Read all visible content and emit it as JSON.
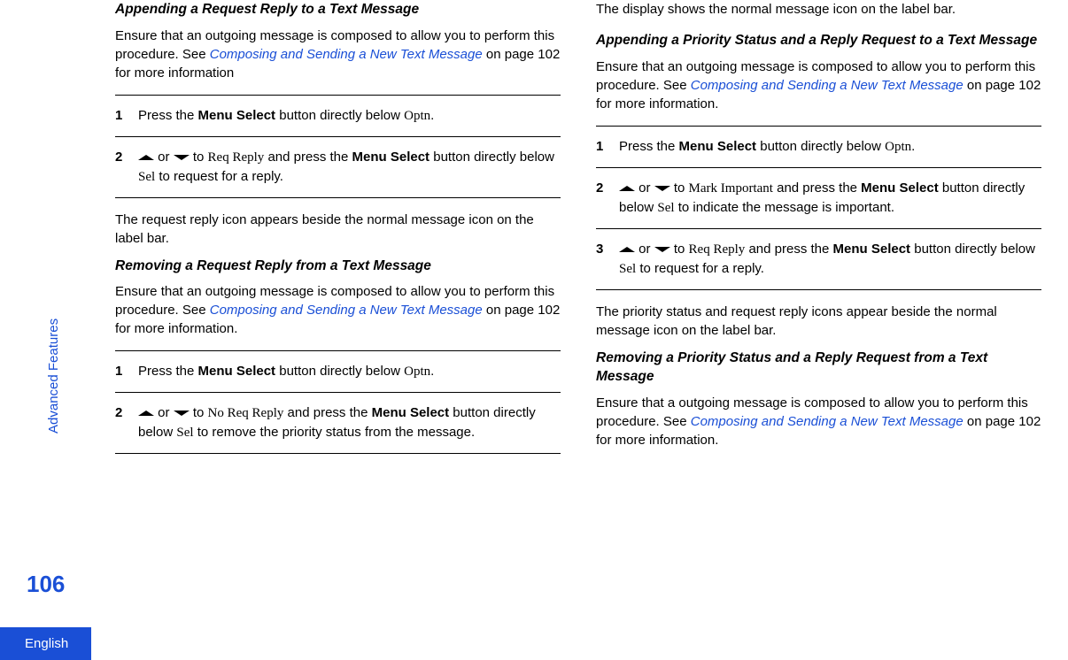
{
  "sidebar": {
    "label": "Advanced Features",
    "page_number": "106",
    "language": "English"
  },
  "left": {
    "sec1": {
      "title": "Appending a Request Reply to a Text Message",
      "intro_pre": "Ensure that an outgoing message is composed to allow you to perform this procedure. See ",
      "intro_link": "Composing and Sending a New Text Message",
      "intro_post": " on page 102 for more information",
      "steps": [
        {
          "num": "1",
          "a": "Press the ",
          "b": "Menu Select",
          "c": " button directly below ",
          "d": "Optn",
          "e": "."
        },
        {
          "num": "2",
          "a": " or ",
          "b": " to ",
          "c": "Req Reply",
          "d": " and press the ",
          "e": "Menu Select",
          "f": " button directly below ",
          "g": "Sel",
          "h": " to request for a reply."
        }
      ],
      "result": "The request reply icon appears beside the normal message icon on the label bar."
    },
    "sec2": {
      "title": "Removing a Request Reply from a Text Message",
      "intro_pre": "Ensure that an outgoing message is composed to allow you to perform this procedure. See ",
      "intro_link": "Composing and Sending a New Text Message",
      "intro_post": " on page 102 for more information.",
      "steps": [
        {
          "num": "1",
          "a": "Press the ",
          "b": "Menu Select",
          "c": " button directly below ",
          "d": "Optn",
          "e": "."
        },
        {
          "num": "2",
          "a": " or ",
          "b": " to ",
          "c": "No Req Reply",
          "d": " and press the ",
          "e": "Menu Select",
          "f": " button directly below ",
          "g": "Sel",
          "h": " to remove the priority status from the message."
        }
      ]
    }
  },
  "right": {
    "top_result": "The display shows the normal message icon on the label bar.",
    "sec3": {
      "title": "Appending a Priority Status and a Reply Request to a Text Message",
      "intro_pre": "Ensure that an outgoing message is composed to allow you to perform this procedure. See ",
      "intro_link": "Composing and Sending a New Text Message",
      "intro_post": " on page 102 for more information.",
      "steps": [
        {
          "num": "1",
          "a": "Press the ",
          "b": "Menu Select",
          "c": " button directly below ",
          "d": "Optn",
          "e": "."
        },
        {
          "num": "2",
          "a": " or ",
          "b": " to ",
          "c": "Mark Important",
          "d": " and press the ",
          "e": "Menu Select",
          "f": " button directly below ",
          "g": "Sel",
          "h": " to indicate the message is important."
        },
        {
          "num": "3",
          "a": " or ",
          "b": " to ",
          "c": "Req Reply",
          "d": " and press the ",
          "e": "Menu Select",
          "f": " button directly below ",
          "g": "Sel",
          "h": " to request for a reply."
        }
      ],
      "result": "The priority status and request reply icons appear beside the normal message icon on the label bar."
    },
    "sec4": {
      "title": "Removing a Priority Status and a Reply Request from a Text Message",
      "intro_pre": "Ensure that a outgoing message is composed to allow you to perform this procedure. See ",
      "intro_link": "Composing and Sending a New Text Message",
      "intro_post": " on page 102 for more information."
    }
  }
}
